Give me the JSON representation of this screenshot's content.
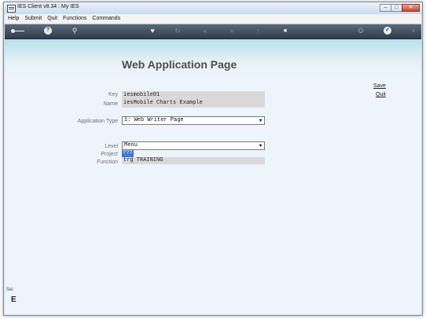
{
  "window": {
    "title": "IES Client v8.34 : My IES",
    "minimize": "–",
    "maximize": "□",
    "close": "✕"
  },
  "menu": [
    "Help",
    "Submit",
    "Quit",
    "Functions",
    "Commands"
  ],
  "toolbar": {
    "icons": [
      "key-icon",
      "help-icon",
      "search-icon",
      "heart-icon",
      "refresh-icon",
      "back-icon",
      "forward-icon",
      "upload-icon",
      "stop-icon",
      "settings-icon",
      "confirm-icon",
      "close-icon"
    ],
    "help_glyph": "?",
    "search_glyph": "⚲",
    "heart_glyph": "♥",
    "refresh_glyph": "↻",
    "back_glyph": "«",
    "forward_glyph": "»",
    "upload_glyph": "↑",
    "stop_glyph": "■",
    "settings_glyph": "✪",
    "confirm_glyph": "✓",
    "close_glyph": "×"
  },
  "page": {
    "title": "Web Application Page",
    "save_label": "Save",
    "quit_label": "Quit"
  },
  "form": {
    "key_label": "Key",
    "key_value": "iesmobile01",
    "name_label": "Name",
    "name_value": "iesMobile Charts Example",
    "app_type_label": "Application Type",
    "app_type_value": "1: Web Writer Page",
    "level_label": "Level",
    "level_value": "Menu",
    "project_label": "Project",
    "project_value": "???",
    "function_label": "Function",
    "function_value": "trg TRAINING"
  },
  "side": {
    "text": "Sei",
    "glyph": "E"
  },
  "colors": {
    "toolbar": "#3f4d5d",
    "banner": "#b9e0ea",
    "content": "#eef4fc",
    "selection": "#3b78d8"
  }
}
